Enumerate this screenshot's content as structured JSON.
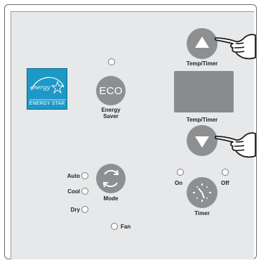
{
  "brand": {
    "name": "ENERGY STAR",
    "script": "energy"
  },
  "eco": {
    "button_label": "ECO",
    "caption_line1": "Energy",
    "caption_line2": "Saver"
  },
  "temp_up": {
    "caption": "Temp/Timer"
  },
  "temp_down": {
    "caption": "Temp/Timer"
  },
  "mode": {
    "caption": "Mode",
    "options": [
      "Auto",
      "Cool",
      "Dry"
    ]
  },
  "fan": {
    "caption": "Fan"
  },
  "timer": {
    "caption": "Timer",
    "on_label": "On",
    "off_label": "Off"
  },
  "colors": {
    "panel_background": "#e6e8ea",
    "button_gray": "#8e8f91",
    "energy_star_blue": "#1e98c7",
    "display_gray": "#8a8b8d"
  }
}
